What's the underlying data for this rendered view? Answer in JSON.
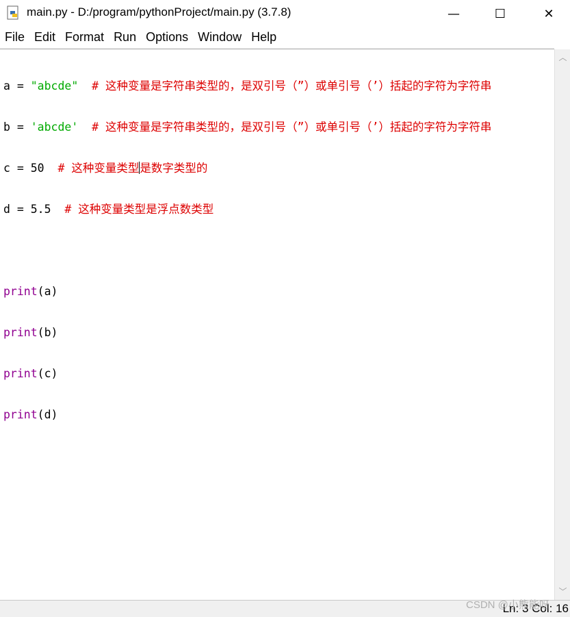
{
  "window": {
    "title": "main.py - D:/program/pythonProject/main.py (3.7.8)",
    "minimize": "—",
    "maximize": "☐",
    "close": "✕"
  },
  "menu": [
    "File",
    "Edit",
    "Format",
    "Run",
    "Options",
    "Window",
    "Help"
  ],
  "code": {
    "line1": {
      "pre": "a = ",
      "str": "\"abcde\"",
      "cmt": "  # 这种变量是字符串类型的，是双引号（”）或单引号（’）括起的字符为字符串"
    },
    "line2": {
      "pre": "b = ",
      "str": "'abcde'",
      "cmt": "  # 这种变量是字符串类型的，是双引号（”）或单引号（’）括起的字符为字符串"
    },
    "line3": {
      "pre": "c = 50  ",
      "cmt_a": "# 这种变量类型",
      "cmt_b": "是数字类型的"
    },
    "line4": {
      "pre": "d = 5.5  ",
      "cmt": "# 这种变量类型是浮点数类型"
    },
    "prints": [
      {
        "kw": "print",
        "arg": "(a)"
      },
      {
        "kw": "print",
        "arg": "(b)"
      },
      {
        "kw": "print",
        "arg": "(c)"
      },
      {
        "kw": "print",
        "arg": "(d)"
      }
    ]
  },
  "status": {
    "text": "Ln: 3  Col: 16"
  },
  "watermark": "CSDN @小熊能呀",
  "colors": {
    "string": "#00aa00",
    "comment": "#dd0000",
    "keyword": "#900090"
  }
}
